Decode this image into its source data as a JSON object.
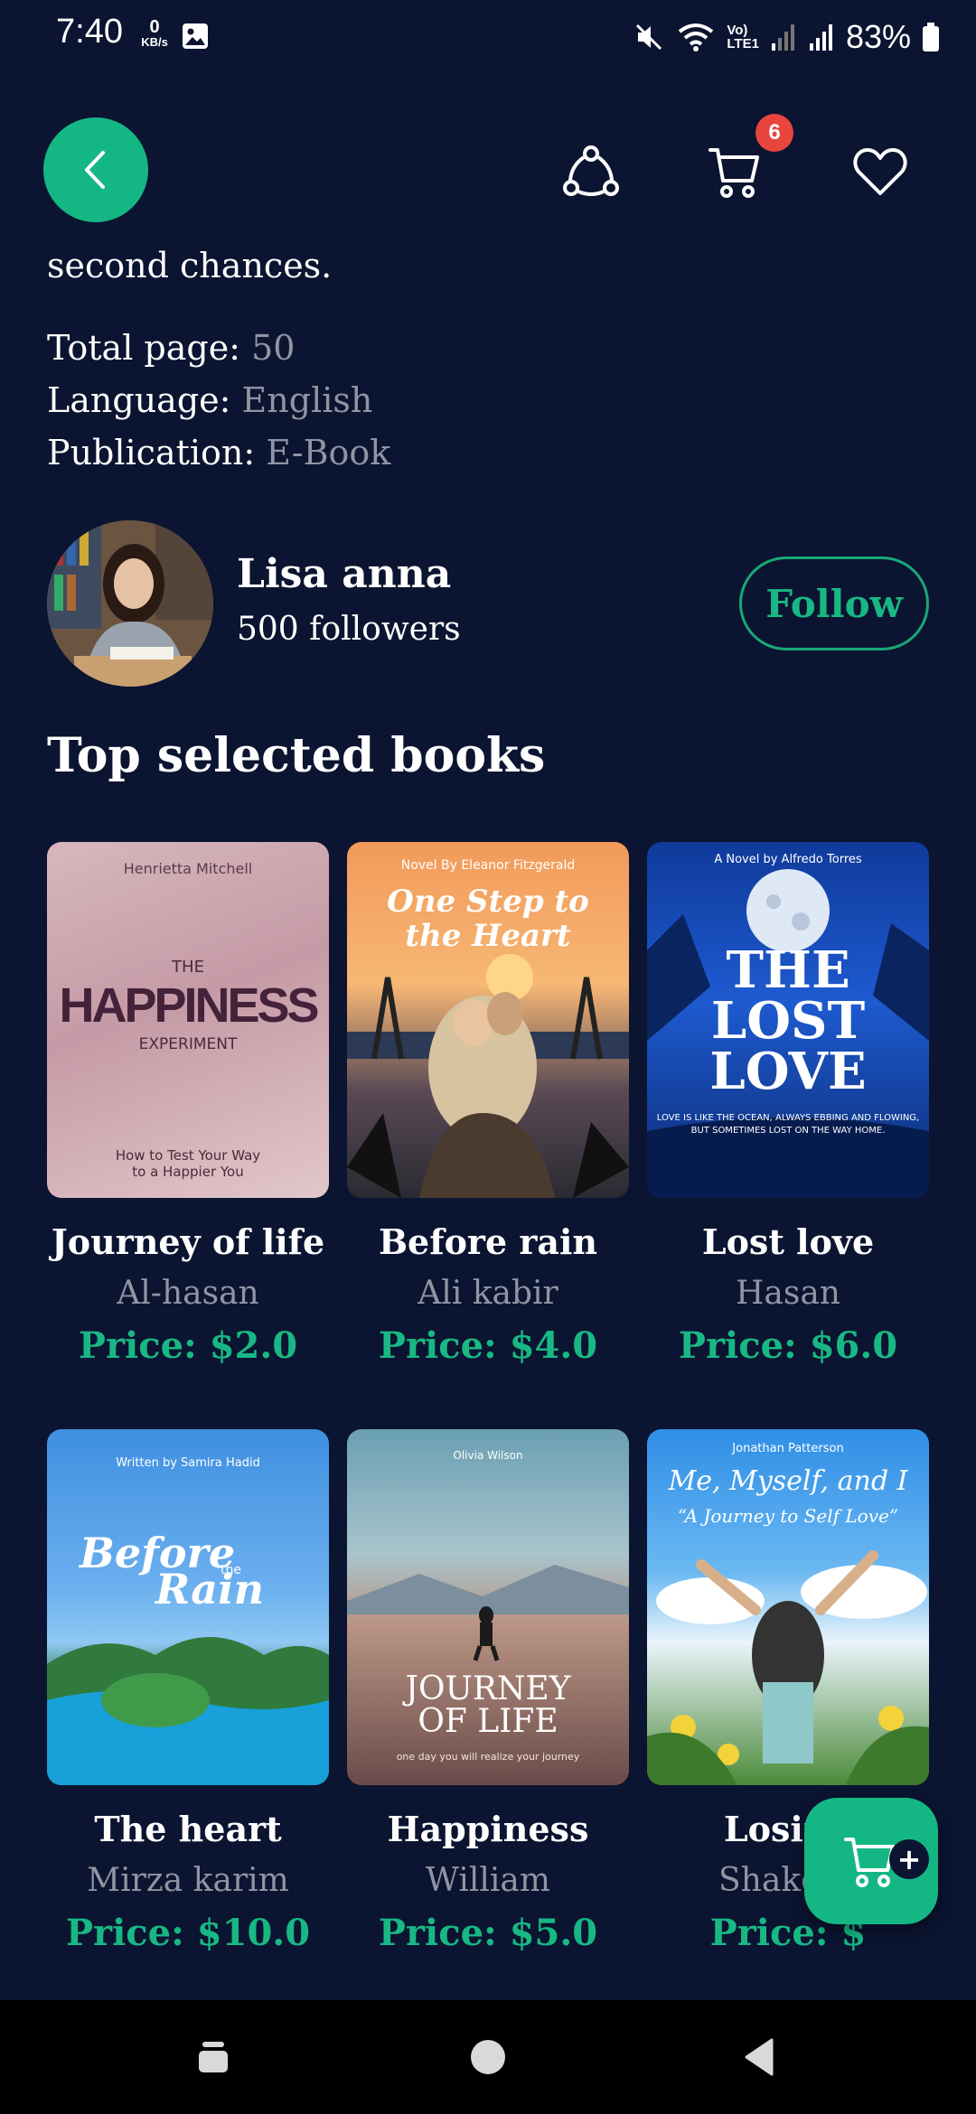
{
  "status_bar": {
    "time": "7:40",
    "net_speed_value": "0",
    "net_speed_unit": "KB/s",
    "network_label_1": "Vo)",
    "network_label_2": "LTE1",
    "battery": "83%"
  },
  "header": {
    "cart_count": "6",
    "icons": [
      "back-arrow-icon",
      "share-icon",
      "cart-icon",
      "heart-icon"
    ]
  },
  "book_details": {
    "description_tail": "second chances.",
    "total_page_label": "Total page:",
    "total_page_value": "50",
    "language_label": "Language:",
    "language_value": "English",
    "publication_label": "Publication:",
    "publication_value": "E-Book"
  },
  "author": {
    "name": "Lisa anna",
    "followers": "500 followers",
    "follow_label": "Follow"
  },
  "section": {
    "title": "Top selected books"
  },
  "books": [
    {
      "title": "Journey of life",
      "author": "Al-hasan",
      "price": "Price: $2.0",
      "cover": {
        "top": "Henrietta Mitchell",
        "small": "THE",
        "big": "HAPPINESS",
        "sub": "EXPERIMENT",
        "bottom_1": "How to Test Your Way",
        "bottom_2": "to a Happier You"
      }
    },
    {
      "title": "Before rain",
      "author": "Ali kabir",
      "price": "Price: $4.0",
      "cover": {
        "top": "Novel By Eleanor Fitzgerald",
        "line1": "One Step to",
        "line2": "the Heart"
      }
    },
    {
      "title": "Lost love",
      "author": "Hasan",
      "price": "Price: $6.0",
      "cover": {
        "top": "A Novel by Alfredo Torres",
        "line1": "THE",
        "line2": "LOST",
        "line3": "LOVE",
        "tag_1": "LOVE IS LIKE THE OCEAN, ALWAYS EBBING AND FLOWING,",
        "tag_2": "BUT SOMETIMES LOST ON THE WAY HOME."
      }
    },
    {
      "title": "The heart",
      "author": "Mirza karim",
      "price": "Price: $10.0",
      "cover": {
        "top": "Written by Samira Hadid",
        "line1": "Before",
        "the": "the",
        "line2": "Rain"
      }
    },
    {
      "title": "Happiness",
      "author": "William",
      "price": "Price: $5.0",
      "cover": {
        "top": "Olivia Wilson",
        "line1": "JOURNEY",
        "line2": "OF LIFE",
        "tag": "one day you will realize your journey"
      }
    },
    {
      "title": "Losing",
      "author": "Shakesp",
      "price": "Price: $",
      "cover": {
        "top": "Jonathan Patterson",
        "line1": "Me, Myself, and I",
        "line2": "“A Journey to Self Love”"
      }
    }
  ],
  "fab": {
    "plus": "+"
  },
  "colors": {
    "background": "#0b1430",
    "accent": "#14b784",
    "price": "#18b884",
    "muted_text": "#8f95a3",
    "badge": "#e8453c"
  }
}
